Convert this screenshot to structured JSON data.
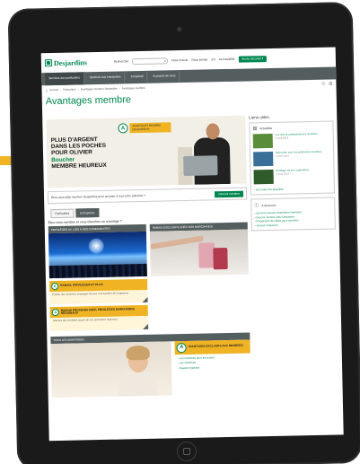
{
  "header": {
    "logo_text": "Desjardins",
    "search_label": "Rechercher",
    "search_icon": "search-icon",
    "links": [
      "Nous trouver",
      "Nous joindre",
      "EN",
      "Accessibilité"
    ],
    "lang": "EN",
    "access_button": "Accès sécurisé",
    "access_icon": "chevron-down-icon"
  },
  "nav": {
    "items": [
      "Services aux particuliers",
      "Services aux entreprises",
      "Coopérati",
      "À propos de nous"
    ]
  },
  "breadcrumb": [
    "Accueil",
    "Particuliers",
    "Avantages membre Desjardins",
    "Avantages membre"
  ],
  "page_title": "Avantages membre",
  "banner": {
    "badge": "AVANTAGES MEMBRE DESJARDINS",
    "line1": "PLUS D'ARGENT",
    "line2": "DANS LES POCHES POUR OLIVIER",
    "name": "Boucher",
    "line4": "MEMBRE HEUREUX"
  },
  "login_prompt": "Êtes-vous déjà membre Desjardins pour accéder à tout votre potentiel ?",
  "login_button": "Devenir membre",
  "tabs": [
    "Particuliers",
    "Entreprises"
  ],
  "question": "Êtes-vous membre et vous cherchez un avantage ?",
  "cards": [
    {
      "header": "PRIVILÈGES AV. LIÉS À NOS COMMANDITES",
      "offers": [
        {
          "title": "RABAIS, PRIVILÈGES ET PLUS",
          "text": "Profitez des nombreux avantages liés aux commandites de l'organisme."
        },
        {
          "title": "RABAIS PROCHAIN CHEF, PRIVILÈGES MARCHANDS RÉGIONAUX",
          "text": "Obtenez des privilèges auprès de nos partenaires régionaux."
        }
      ]
    },
    {
      "header": "RABAIS EXCLUSIFS CHEZ NOS MARCHANDS",
      "offers": []
    }
  ],
  "all_section": {
    "header": "TOUS LES AVANTAGES",
    "offer_title": "AVANTAGES EXCLUSIFS AUX MEMBRES",
    "list": [
      "Les membres pour les jeunes",
      "Les membres",
      "Devenir membre"
    ]
  },
  "side": {
    "title": "Liens utiles",
    "box1_head": "Actualités",
    "news": [
      {
        "text": "Les avis de participants des membres",
        "date": "5 avril 2014",
        "color": "#5a8d3a"
      },
      {
        "text": "Rencontre avec les partenaires membres",
        "date": "2 avril 2014",
        "color": "#3a6f9a"
      },
      {
        "text": "Sondage sur les coopératives",
        "date": "1 avril 2014",
        "color": "#2f5a2a"
      }
    ],
    "see_all": "Voir toutes les actualités",
    "box2_head": "À découvrir",
    "box2_links": [
      "Qu'est-ce qu'une coopérative financière",
      "Devenir membre chez Desjardins",
      "Programme de rabais pour membres",
      "Services financiers"
    ]
  }
}
